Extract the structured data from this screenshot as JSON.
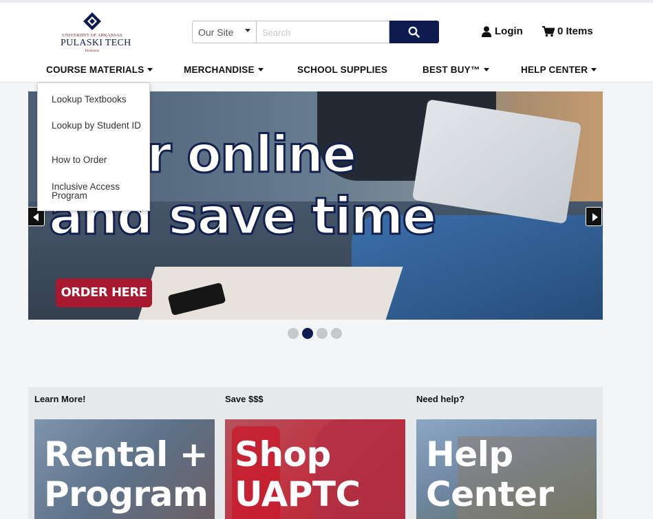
{
  "header": {
    "logo": {
      "line1": "UNIVERSITY OF ARKANSAS",
      "line2": "PULASKI TECH",
      "line3": "Bookstore"
    },
    "search": {
      "scope": "Our Site",
      "placeholder": "Search"
    },
    "login_label": "Login",
    "cart_label": "0 Items"
  },
  "nav": [
    {
      "label": "COURSE MATERIALS",
      "has_dropdown": true
    },
    {
      "label": "MERCHANDISE",
      "has_dropdown": true
    },
    {
      "label": "SCHOOL SUPPLIES",
      "has_dropdown": false
    },
    {
      "label": "BEST BUY™",
      "has_dropdown": true
    },
    {
      "label": "HELP CENTER",
      "has_dropdown": true
    }
  ],
  "dropdown": {
    "items": [
      "Lookup Textbooks",
      "Lookup by Student ID",
      "How to Order",
      "Inclusive Access Program"
    ]
  },
  "hero": {
    "line1": "r online",
    "line2": "and save time",
    "button_label": "ORDER HERE",
    "slide_count": 4,
    "active_slide": 2
  },
  "promos": [
    {
      "label": "Learn More!",
      "card_text_1": "Rental +",
      "card_text_2": "Program"
    },
    {
      "label": "Save $$$",
      "card_text_1": "Shop",
      "card_text_2": "UAPTC"
    },
    {
      "label": "Need help?",
      "card_text_1": "Help",
      "card_text_2": "Center"
    }
  ],
  "colors": {
    "brand_navy": "#0f1a4e",
    "brand_red": "#a8182f"
  },
  "icons": {
    "search": "search-icon",
    "user": "user-icon",
    "cart": "cart-icon"
  }
}
